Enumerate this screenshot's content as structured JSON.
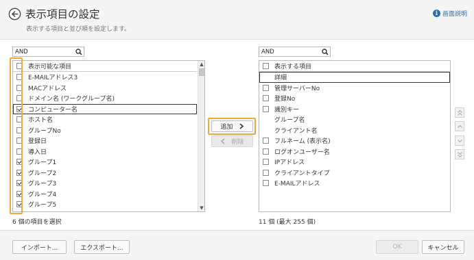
{
  "header": {
    "title": "表示項目の設定",
    "subtitle": "表示する項目と並び順を設定します。",
    "help_label": "画面説明"
  },
  "left": {
    "search_value": "AND",
    "column_header": "表示可能な項目",
    "items": [
      {
        "label": "E-MAILアドレス3",
        "checked": false
      },
      {
        "label": "MACアドレス",
        "checked": false
      },
      {
        "label": "ドメイン名 (ワークグループ名)",
        "checked": false
      },
      {
        "label": "コンピューター名",
        "checked": true
      },
      {
        "label": "ホスト名",
        "checked": false
      },
      {
        "label": "グループNo",
        "checked": false
      },
      {
        "label": "登録日",
        "checked": false
      },
      {
        "label": "導入日",
        "checked": false
      },
      {
        "label": "グループ1",
        "checked": true
      },
      {
        "label": "グループ2",
        "checked": true
      },
      {
        "label": "グループ3",
        "checked": true
      },
      {
        "label": "グループ4",
        "checked": true
      },
      {
        "label": "グループ5",
        "checked": true
      }
    ],
    "count_text": "6 個の項目を選択"
  },
  "middle": {
    "add_label": "追加",
    "remove_label": "削除"
  },
  "right": {
    "search_value": "AND",
    "column_header": "表示する項目",
    "items": [
      {
        "label": "詳細",
        "checkbox": false
      },
      {
        "label": "管理サーバーNo",
        "checkbox": true
      },
      {
        "label": "登録No",
        "checkbox": true
      },
      {
        "label": "識別キー",
        "checkbox": true
      },
      {
        "label": "グループ名",
        "checkbox": false
      },
      {
        "label": "クライアント名",
        "checkbox": false
      },
      {
        "label": "フルネーム (表示名)",
        "checkbox": true
      },
      {
        "label": "ログオンユーザー名",
        "checkbox": true
      },
      {
        "label": "IPアドレス",
        "checkbox": true
      },
      {
        "label": "クライアントタイプ",
        "checkbox": true
      },
      {
        "label": "E-MAILアドレス",
        "checkbox": true
      }
    ],
    "count_text": "11 個 (最大 255 個)"
  },
  "footer": {
    "import_label": "インポート...",
    "export_label": "エクスポート...",
    "ok_label": "OK",
    "cancel_label": "キャンセル"
  },
  "colors": {
    "highlight": "#f2a73b",
    "link": "#2a6fb4"
  }
}
